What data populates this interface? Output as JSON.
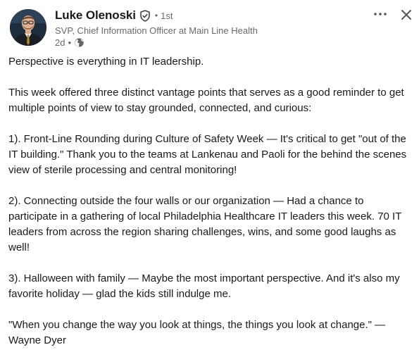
{
  "post": {
    "author": {
      "name": "Luke Olenoski",
      "connection_degree": "1st",
      "headline": "SVP, Chief Information Officer at Main Line Health",
      "time_ago": "2d",
      "visibility_icon": "globe-icon",
      "verified_icon": "verified-badge-icon"
    },
    "actions": {
      "more_icon": "more-horizontal-icon",
      "close_icon": "close-icon"
    },
    "body": [
      "Perspective is everything in IT leadership.",
      "This week offered three distinct vantage points that serves as a good reminder to get multiple points of view to stay grounded, connected, and curious:",
      "1). Front-Line Rounding during Culture of Safety Week — It's critical to get \"out of the IT building.\" Thank you to the teams at Lankenau and Paoli for the behind the scenes view of sterile processing and central monitoring!",
      "2). Connecting outside the four walls or our organization — Had a chance to participate in a gathering of local Philadelphia Healthcare IT leaders this week. 70 IT leaders from across the region sharing challenges, wins, and some good laughs as well!",
      "3). Halloween with family — Maybe the most important perspective. And it's also my favorite holiday — glad the kids still indulge me.",
      "\"When you change the way you look at things, the things you look at change.\" — Wayne Dyer"
    ]
  }
}
